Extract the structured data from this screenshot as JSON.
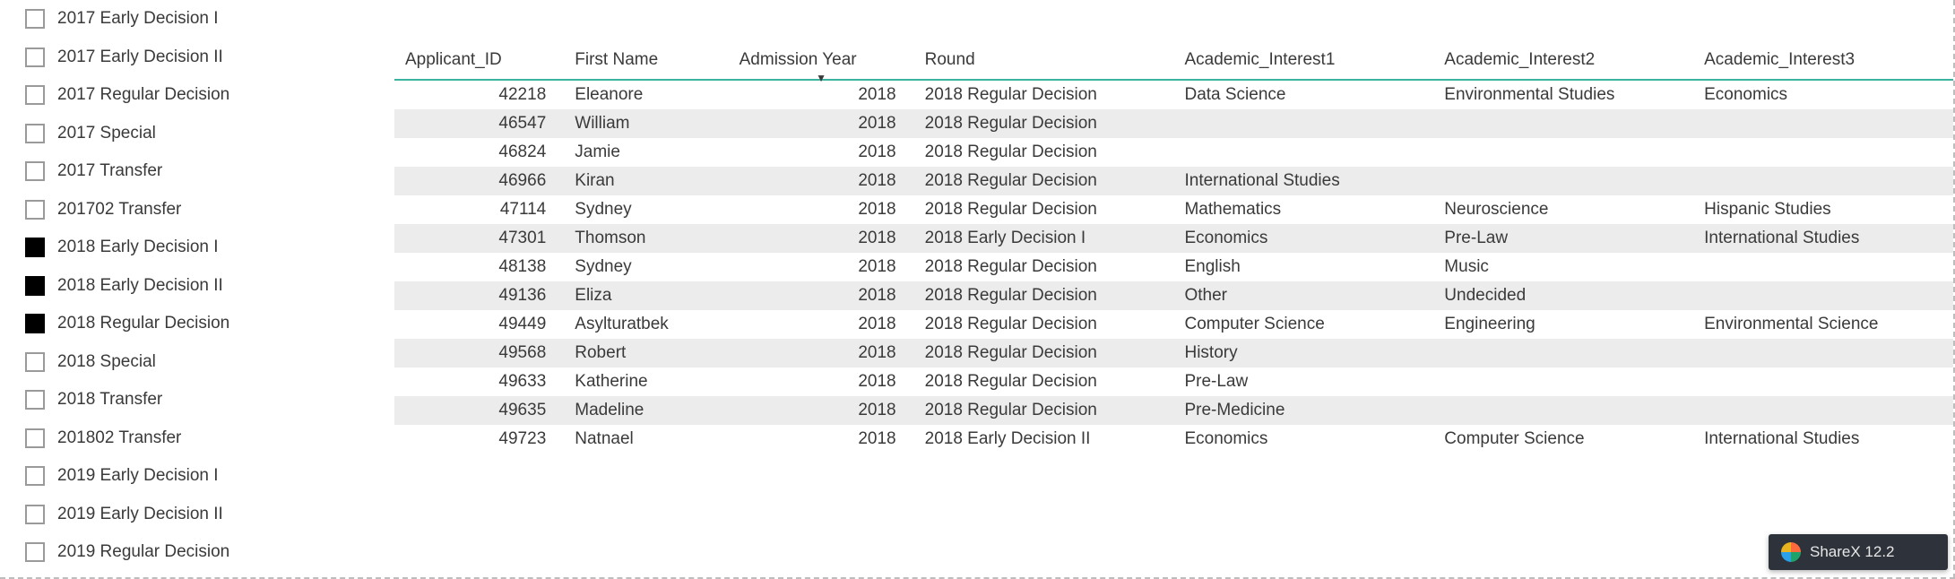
{
  "slicer": {
    "items": [
      {
        "label": "2017 Early Decision I",
        "checked": false
      },
      {
        "label": "2017 Early Decision II",
        "checked": false
      },
      {
        "label": "2017 Regular Decision",
        "checked": false
      },
      {
        "label": "2017 Special",
        "checked": false
      },
      {
        "label": "2017 Transfer",
        "checked": false
      },
      {
        "label": "201702 Transfer",
        "checked": false
      },
      {
        "label": "2018 Early Decision I",
        "checked": true
      },
      {
        "label": "2018 Early Decision II",
        "checked": true
      },
      {
        "label": "2018 Regular Decision",
        "checked": true
      },
      {
        "label": "2018 Special",
        "checked": false
      },
      {
        "label": "2018 Transfer",
        "checked": false
      },
      {
        "label": "201802 Transfer",
        "checked": false
      },
      {
        "label": "2019 Early Decision I",
        "checked": false
      },
      {
        "label": "2019 Early Decision II",
        "checked": false
      },
      {
        "label": "2019 Regular Decision",
        "checked": false
      }
    ]
  },
  "table": {
    "columns": [
      {
        "key": "id",
        "label": "Applicant_ID",
        "sorted": false,
        "numeric": true
      },
      {
        "key": "first",
        "label": "First Name",
        "sorted": false,
        "numeric": false
      },
      {
        "key": "year",
        "label": "Admission Year",
        "sorted": true,
        "numeric": true
      },
      {
        "key": "round",
        "label": "Round",
        "sorted": false,
        "numeric": false
      },
      {
        "key": "i1",
        "label": "Academic_Interest1",
        "sorted": false,
        "numeric": false
      },
      {
        "key": "i2",
        "label": "Academic_Interest2",
        "sorted": false,
        "numeric": false
      },
      {
        "key": "i3",
        "label": "Academic_Interest3",
        "sorted": false,
        "numeric": false
      }
    ],
    "rows": [
      {
        "id": "42218",
        "first": "Eleanore",
        "year": "2018",
        "round": "2018 Regular Decision",
        "i1": "Data Science",
        "i2": "Environmental Studies",
        "i3": "Economics"
      },
      {
        "id": "46547",
        "first": "William",
        "year": "2018",
        "round": "2018 Regular Decision",
        "i1": "",
        "i2": "",
        "i3": ""
      },
      {
        "id": "46824",
        "first": "Jamie",
        "year": "2018",
        "round": "2018 Regular Decision",
        "i1": "",
        "i2": "",
        "i3": ""
      },
      {
        "id": "46966",
        "first": "Kiran",
        "year": "2018",
        "round": "2018 Regular Decision",
        "i1": "International Studies",
        "i2": "",
        "i3": ""
      },
      {
        "id": "47114",
        "first": "Sydney",
        "year": "2018",
        "round": "2018 Regular Decision",
        "i1": "Mathematics",
        "i2": "Neuroscience",
        "i3": "Hispanic Studies"
      },
      {
        "id": "47301",
        "first": "Thomson",
        "year": "2018",
        "round": "2018 Early Decision I",
        "i1": "Economics",
        "i2": "Pre-Law",
        "i3": "International Studies"
      },
      {
        "id": "48138",
        "first": "Sydney",
        "year": "2018",
        "round": "2018 Regular Decision",
        "i1": "English",
        "i2": "Music",
        "i3": ""
      },
      {
        "id": "49136",
        "first": "Eliza",
        "year": "2018",
        "round": "2018 Regular Decision",
        "i1": "Other",
        "i2": "Undecided",
        "i3": ""
      },
      {
        "id": "49449",
        "first": "Asylturatbek",
        "year": "2018",
        "round": "2018 Regular Decision",
        "i1": "Computer Science",
        "i2": "Engineering",
        "i3": "Environmental Science"
      },
      {
        "id": "49568",
        "first": "Robert",
        "year": "2018",
        "round": "2018 Regular Decision",
        "i1": "History",
        "i2": "",
        "i3": ""
      },
      {
        "id": "49633",
        "first": "Katherine",
        "year": "2018",
        "round": "2018 Regular Decision",
        "i1": "Pre-Law",
        "i2": "",
        "i3": ""
      },
      {
        "id": "49635",
        "first": "Madeline",
        "year": "2018",
        "round": "2018 Regular Decision",
        "i1": "Pre-Medicine",
        "i2": "",
        "i3": ""
      },
      {
        "id": "49723",
        "first": "Natnael",
        "year": "2018",
        "round": "2018 Early Decision II",
        "i1": "Economics",
        "i2": "Computer Science",
        "i3": "International Studies"
      }
    ]
  },
  "overlay": {
    "sharex_label": "ShareX 12.2"
  }
}
